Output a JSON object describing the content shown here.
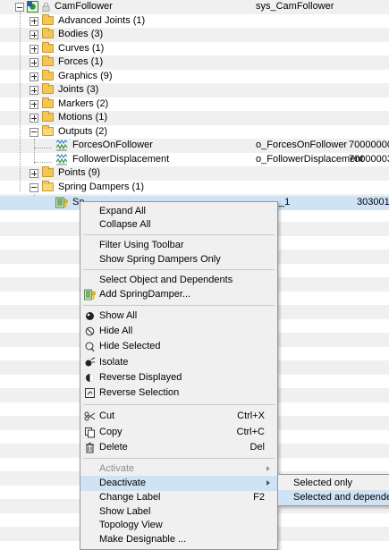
{
  "tree": {
    "root": {
      "label": "CamFollower",
      "var_name": "sys_CamFollower"
    },
    "folders": [
      {
        "label": "Advanced Joints  (1)"
      },
      {
        "label": "Bodies  (3)"
      },
      {
        "label": "Curves  (1)"
      },
      {
        "label": "Forces  (1)"
      },
      {
        "label": "Graphics  (9)"
      },
      {
        "label": "Joints  (3)"
      },
      {
        "label": "Markers  (2)"
      },
      {
        "label": "Motions  (1)"
      },
      {
        "label": "Outputs  (2)"
      },
      {
        "label": "Points  (9)"
      },
      {
        "label": "Spring Dampers  (1)"
      }
    ],
    "outputs": [
      {
        "label": "ForcesOnFollower",
        "var_name": "o_ForcesOnFollower",
        "id": "70000000"
      },
      {
        "label": "FollowerDisplacement",
        "var_name": "o_FollowerDisplacement",
        "id": "70000003"
      }
    ],
    "spring": {
      "label": "Sp",
      "id": "303001",
      "var_name_fragment": "_1"
    }
  },
  "context_menu": {
    "expand_all": "Expand All",
    "collapse_all": "Collapse All",
    "filter_using_toolbar": "Filter Using Toolbar",
    "show_only": "Show Spring Dampers Only",
    "select_dependents": "Select Object and Dependents",
    "add_spring": "Add SpringDamper...",
    "show_all": "Show All",
    "hide_all": "Hide All",
    "hide_selected": "Hide Selected",
    "isolate": "Isolate",
    "reverse_displayed": "Reverse Displayed",
    "reverse_selection": "Reverse Selection",
    "cut": "Cut",
    "cut_shortcut": "Ctrl+X",
    "copy": "Copy",
    "copy_shortcut": "Ctrl+C",
    "delete": "Delete",
    "delete_shortcut": "Del",
    "activate": "Activate",
    "deactivate": "Deactivate",
    "change_label": "Change Label",
    "change_label_shortcut": "F2",
    "show_label": "Show Label",
    "topology_view": "Topology View",
    "make_designable": "Make Designable ..."
  },
  "submenu": {
    "selected_only": "Selected only",
    "selected_and_dependents": "Selected and dependents"
  },
  "icons": {
    "tree_folder": "folder-icon",
    "output": "output-icon",
    "spring_damper": "spring-damper-icon",
    "system": "system-icon"
  }
}
